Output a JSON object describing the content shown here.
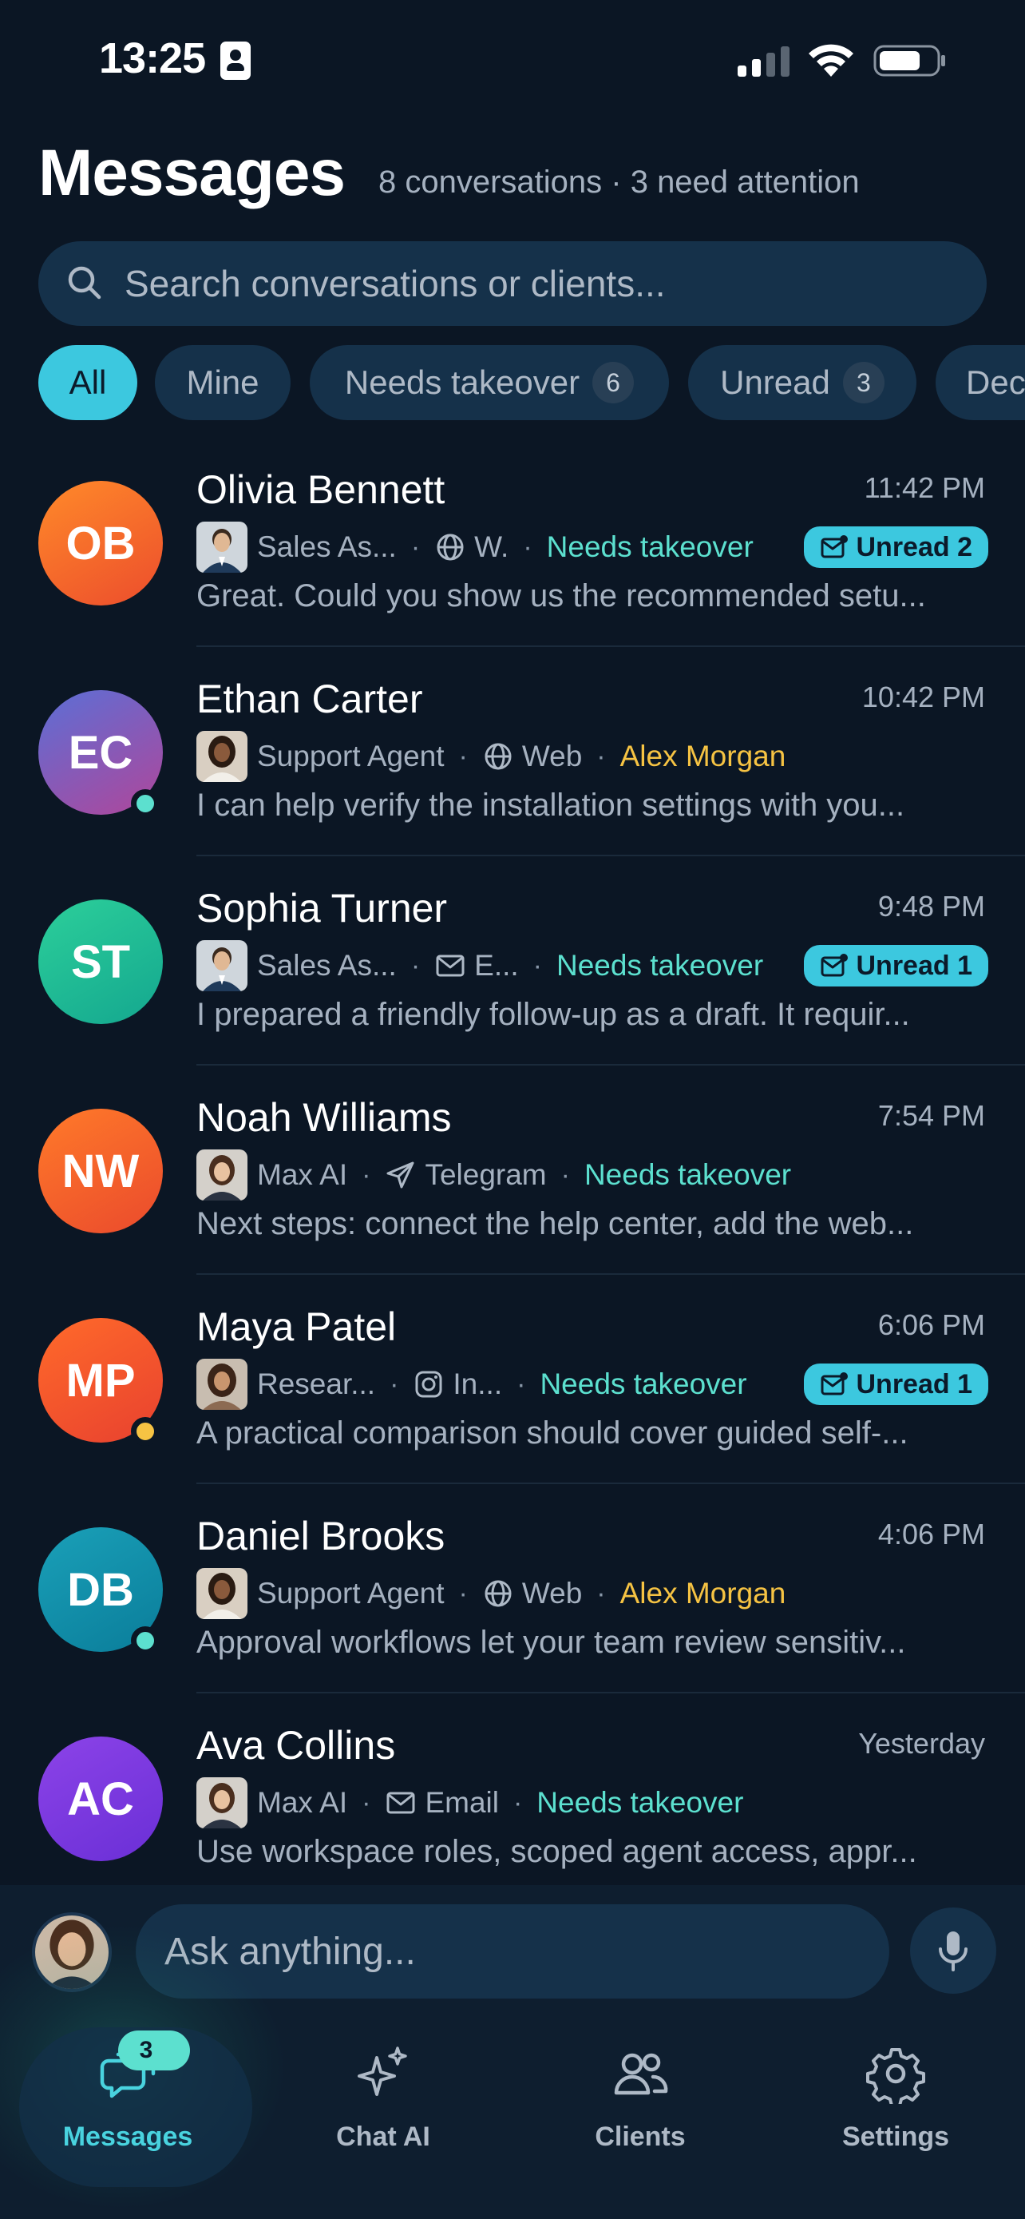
{
  "status_bar": {
    "time": "13:25"
  },
  "header": {
    "title": "Messages",
    "subtitle": "8 conversations · 3 need attention"
  },
  "search": {
    "placeholder": "Search conversations or clients..."
  },
  "filters": [
    {
      "label": "All",
      "active": true
    },
    {
      "label": "Mine"
    },
    {
      "label": "Needs takeover",
      "count": "6"
    },
    {
      "label": "Unread",
      "count": "3"
    },
    {
      "label": "Dec"
    }
  ],
  "conversations": [
    {
      "initials": "OB",
      "name": "Olivia Bennett",
      "time": "11:42 PM",
      "agent": "Sales As...",
      "agent_avatar": "male",
      "channel": "W.",
      "channel_icon": "globe-icon",
      "status": "Needs takeover",
      "status_color": "#5ce0cf",
      "unread": "Unread 2",
      "preview": "Great. Could you show us the recommended setu...",
      "avatar_gradient": [
        "#ff8a2a",
        "#ec4d2c"
      ],
      "presence": ""
    },
    {
      "initials": "EC",
      "name": "Ethan Carter",
      "time": "10:42 PM",
      "agent": "Support Agent",
      "agent_avatar": "female",
      "channel": "Web",
      "channel_icon": "globe-icon",
      "status": "Alex Morgan",
      "status_color": "#f6c343",
      "unread": "",
      "preview": "I can help verify the installation settings with you...",
      "avatar_gradient": [
        "#5b6fd6",
        "#b0469a"
      ],
      "presence": "#5ce0cf"
    },
    {
      "initials": "ST",
      "name": "Sophia Turner",
      "time": "9:48 PM",
      "agent": "Sales As...",
      "agent_avatar": "male",
      "channel": "E...",
      "channel_icon": "mail-icon",
      "status": "Needs takeover",
      "status_color": "#5ce0cf",
      "unread": "Unread 1",
      "preview": "I prepared a friendly follow-up as a draft. It requir...",
      "avatar_gradient": [
        "#2ccf9a",
        "#14a78f"
      ],
      "presence": ""
    },
    {
      "initials": "NW",
      "name": "Noah Williams",
      "time": "7:54 PM",
      "agent": "Max AI",
      "agent_avatar": "woman",
      "channel": "Telegram",
      "channel_icon": "send-icon",
      "status": "Needs takeover",
      "status_color": "#5ce0cf",
      "unread": "",
      "preview": "Next steps: connect the help center, add the web...",
      "avatar_gradient": [
        "#ff7a2a",
        "#ea4a2c"
      ],
      "presence": ""
    },
    {
      "initials": "MP",
      "name": "Maya Patel",
      "time": "6:06 PM",
      "agent": "Resear...",
      "agent_avatar": "woman2",
      "channel": "In...",
      "channel_icon": "instagram-icon",
      "status": "Needs takeover",
      "status_color": "#5ce0cf",
      "unread": "Unread 1",
      "preview": "A practical comparison should cover guided self-...",
      "avatar_gradient": [
        "#ff6a2a",
        "#e8412f"
      ],
      "presence": "#f6c343"
    },
    {
      "initials": "DB",
      "name": "Daniel Brooks",
      "time": "4:06 PM",
      "agent": "Support Agent",
      "agent_avatar": "female",
      "channel": "Web",
      "channel_icon": "globe-icon",
      "status": "Alex Morgan",
      "status_color": "#f6c343",
      "unread": "",
      "preview": "Approval workflows let your team review sensitiv...",
      "avatar_gradient": [
        "#1aa0b8",
        "#0a7d9a"
      ],
      "presence": "#5ce0cf"
    },
    {
      "initials": "AC",
      "name": "Ava Collins",
      "time": "Yesterday",
      "agent": "Max AI",
      "agent_avatar": "woman",
      "channel": "Email",
      "channel_icon": "mail-icon",
      "status": "Needs takeover",
      "status_color": "#5ce0cf",
      "unread": "",
      "preview": "Use workspace roles, scoped agent access, appr...",
      "avatar_gradient": [
        "#8c43e8",
        "#6a2fd6"
      ],
      "presence": ""
    }
  ],
  "composer": {
    "placeholder": "Ask anything..."
  },
  "tabs": [
    {
      "label": "Messages",
      "icon": "chat-bubbles-icon",
      "active": true,
      "badge": "3"
    },
    {
      "label": "Chat AI",
      "icon": "sparkles-icon"
    },
    {
      "label": "Clients",
      "icon": "people-icon"
    },
    {
      "label": "Settings",
      "icon": "gear-icon"
    }
  ],
  "colors": {
    "background": "#0b1624",
    "accent": "#3cc8df",
    "needs_takeover": "#5ce0cf",
    "assignee": "#f6c343"
  }
}
